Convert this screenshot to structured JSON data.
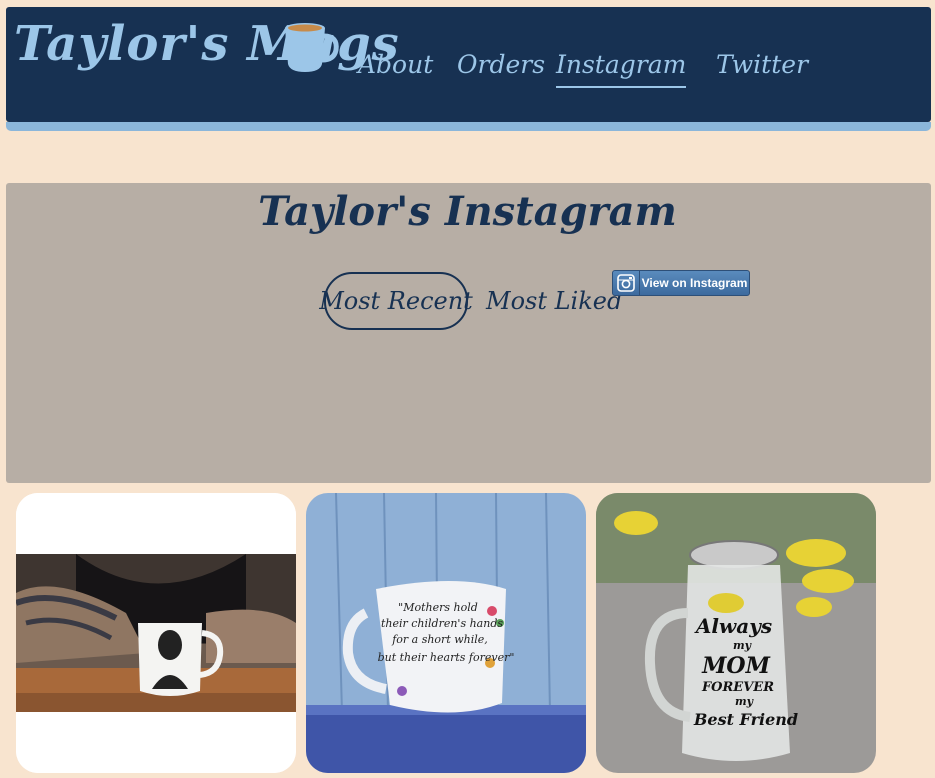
{
  "header": {
    "logo_text": "Taylor's Mugs",
    "nav": [
      {
        "label": "About"
      },
      {
        "label": "Orders"
      },
      {
        "label": "Instagram",
        "active": true
      },
      {
        "label": "Twitter"
      }
    ]
  },
  "instagram": {
    "title": "Taylor's Instagram",
    "filters": [
      "Most Recent",
      "Most Liked"
    ],
    "view_button_label": "View on Instagram"
  },
  "photos": [
    {
      "mug_text": ""
    },
    {
      "mug_text": [
        "\"Mothers hold",
        "their children's hands",
        "for a short while,",
        "but their hearts forever\""
      ]
    },
    {
      "mug_text": [
        "Always",
        "my",
        "MOM",
        "FOREVER",
        "my",
        "Best Friend"
      ]
    }
  ],
  "colors": {
    "header_bg": "#173152",
    "accent_light_blue": "#9cc6e8",
    "page_bg": "#f8e4cf",
    "panel_bg": "#b7aea5"
  }
}
